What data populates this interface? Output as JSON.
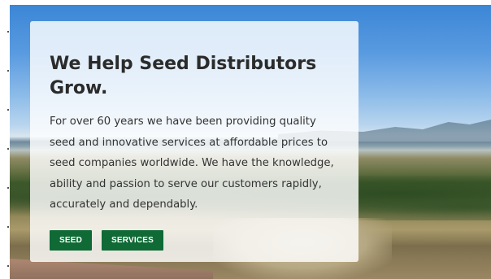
{
  "hero": {
    "headline": "We Help Seed Distributors Grow.",
    "body": "For over 60 years we have been providing quality seed and innovative services at affordable prices to seed companies worldwide. We have the knowledge, ability and passion to serve our customers rapidly, accurately and dependably.",
    "buttons": [
      {
        "label": "SEED"
      },
      {
        "label": "SERVICES"
      }
    ]
  },
  "colors": {
    "button_bg": "#0f6a35",
    "card_bg": "#ffffffd1",
    "headline": "#2b2b2b"
  }
}
